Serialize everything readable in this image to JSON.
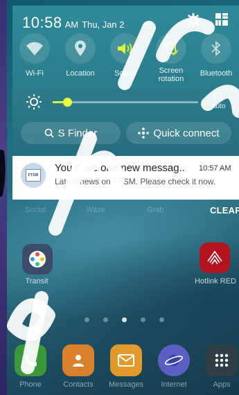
{
  "status": {
    "time": "10:58",
    "ampm": "AM",
    "date": "Thu, Jan 2"
  },
  "quick_toggles": [
    {
      "label": "Wi-Fi",
      "icon": "wifi-icon",
      "active": false
    },
    {
      "label": "Location",
      "icon": "location-icon",
      "active": false
    },
    {
      "label": "Sound",
      "icon": "sound-icon",
      "active": true
    },
    {
      "label": "Screen\nrotation",
      "icon": "screen-rotation-icon",
      "active": true
    },
    {
      "label": "Bluetooth",
      "icon": "bluetooth-icon",
      "active": false
    }
  ],
  "brightness": {
    "level": 0.1,
    "auto_label": "Auto"
  },
  "buttons": {
    "s_finder": "S Finder",
    "quick_connect": "Quick connect",
    "clear": "CLEAR"
  },
  "notification": {
    "app_logo_text": "FTSM",
    "title": "You have one new messag..",
    "time": "10:57 AM",
    "body": "Latest news on FTSM. Please check it now."
  },
  "home": {
    "faded_labels": [
      "Social",
      "Waze",
      "Grab"
    ],
    "apps": [
      {
        "label": "Transit"
      },
      {
        "label": "Hotlink RED"
      }
    ],
    "dock": [
      {
        "label": "Phone",
        "icon": "phone-icon",
        "color": "#3a9a3a"
      },
      {
        "label": "Contacts",
        "icon": "contacts-icon",
        "color": "#d9812a"
      },
      {
        "label": "Messages",
        "icon": "messages-icon",
        "color": "#e39a2c"
      },
      {
        "label": "Internet",
        "icon": "internet-icon",
        "color": "#5b5fc4"
      },
      {
        "label": "Apps",
        "icon": "apps-grid-icon",
        "color": "#2e3e44"
      }
    ]
  },
  "colors": {
    "panel": "#2c7f8e",
    "active_toggle": "#d7f53a",
    "slider": "#e5ff3a"
  }
}
